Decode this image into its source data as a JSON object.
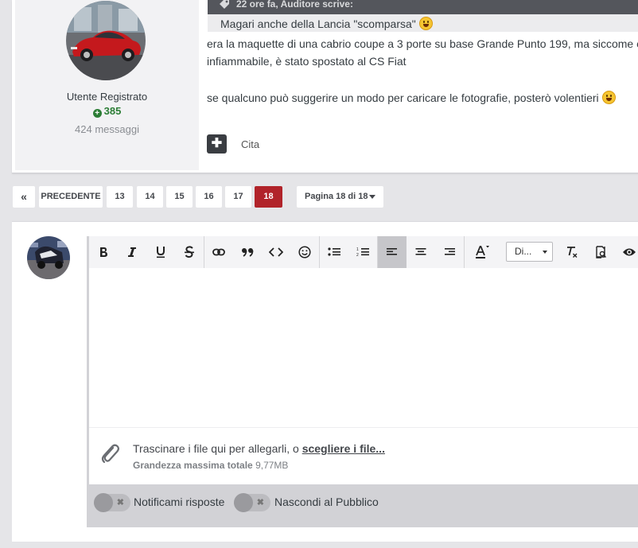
{
  "post": {
    "author": {
      "group": "Utente Registrato",
      "reputation": "385",
      "posts": "424 messaggi"
    },
    "quote_header": "22 ore fa, Auditore scrive:",
    "quote_text": "Magari anche della Lancia \"scomparsa\"",
    "body_line1": "era la maquette di una cabrio coupe a 3 porte su base Grande Punto 199, ma siccome e",
    "body_line2": "infiammabile, è stato spostato al CS Fiat",
    "body_line3": "se qualcuno può suggerire un modo per caricare le fotografie, posterò volentieri",
    "plus_label": "✚",
    "quote_button": "Cita"
  },
  "pagination": {
    "first_label": "«",
    "prev_label": "PRECEDENTE",
    "pages": [
      "13",
      "14",
      "15",
      "16",
      "17",
      "18"
    ],
    "current": "18",
    "jump_label": "Pagina 18 di 18"
  },
  "editor": {
    "toolbar": [
      "bold",
      "italic",
      "underline",
      "strikethrough",
      "link",
      "quote",
      "code",
      "emoji",
      "bulleted-list",
      "numbered-list",
      "align-left",
      "align-center",
      "align-right",
      "text-color",
      "font",
      "remove-format",
      "preview-source",
      "preview"
    ],
    "font_label": "Di...",
    "attach_text": "Trascinare i file qui per allegarli, o ",
    "attach_link": "scegliere i file...",
    "max_size_label": "Grandezza massima totale",
    "max_size_value": "9,77MB"
  },
  "options": {
    "notify_label": "Notificami risposte",
    "hide_label": "Nascondi al Pubblico"
  },
  "colors": {
    "active_page": "#b1232a",
    "reputation": "#2b7d35",
    "quote_header_bg": "#54565c"
  }
}
